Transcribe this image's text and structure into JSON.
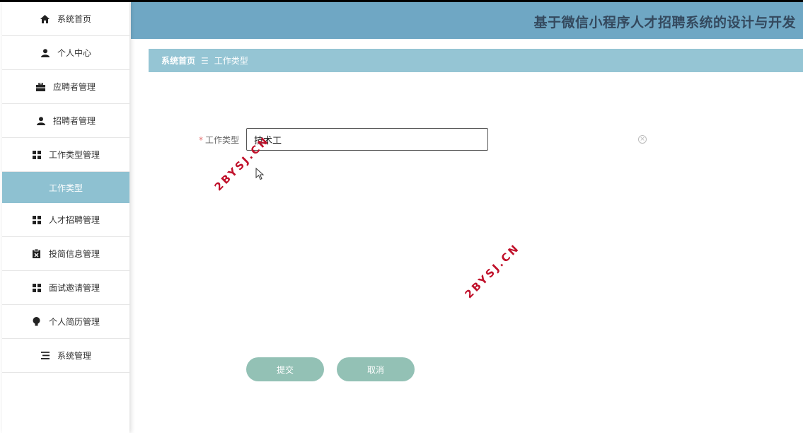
{
  "sidebar": {
    "items": [
      {
        "label": "系统首页",
        "icon": "home-icon"
      },
      {
        "label": "个人中心",
        "icon": "user-icon"
      },
      {
        "label": "应聘者管理",
        "icon": "briefcase-icon"
      },
      {
        "label": "招聘者管理",
        "icon": "user-icon"
      },
      {
        "label": "工作类型管理",
        "icon": "grid-icon"
      },
      {
        "label": "工作类型",
        "icon": "",
        "active": true
      },
      {
        "label": "人才招聘管理",
        "icon": "grid-icon"
      },
      {
        "label": "投简信息管理",
        "icon": "clipboard-icon"
      },
      {
        "label": "面试邀请管理",
        "icon": "grid-icon"
      },
      {
        "label": "个人简历管理",
        "icon": "bulb-icon"
      },
      {
        "label": "系统管理",
        "icon": "list-icon"
      }
    ]
  },
  "header": {
    "title": "基于微信小程序人才招聘系统的设计与开发"
  },
  "breadcrumb": {
    "home": "系统首页",
    "separator": "☰",
    "current": "工作类型"
  },
  "form": {
    "required_mark": "*",
    "field_label": "工作类型",
    "field_value": "技术工"
  },
  "buttons": {
    "submit": "提交",
    "cancel": "取消"
  },
  "watermark": {
    "text": "2BYSJ.CN"
  },
  "colors": {
    "header": "#6fa7c4",
    "active": "#8ec1d1",
    "breadcrumb": "#95c5d4",
    "button": "#93c1b5"
  }
}
